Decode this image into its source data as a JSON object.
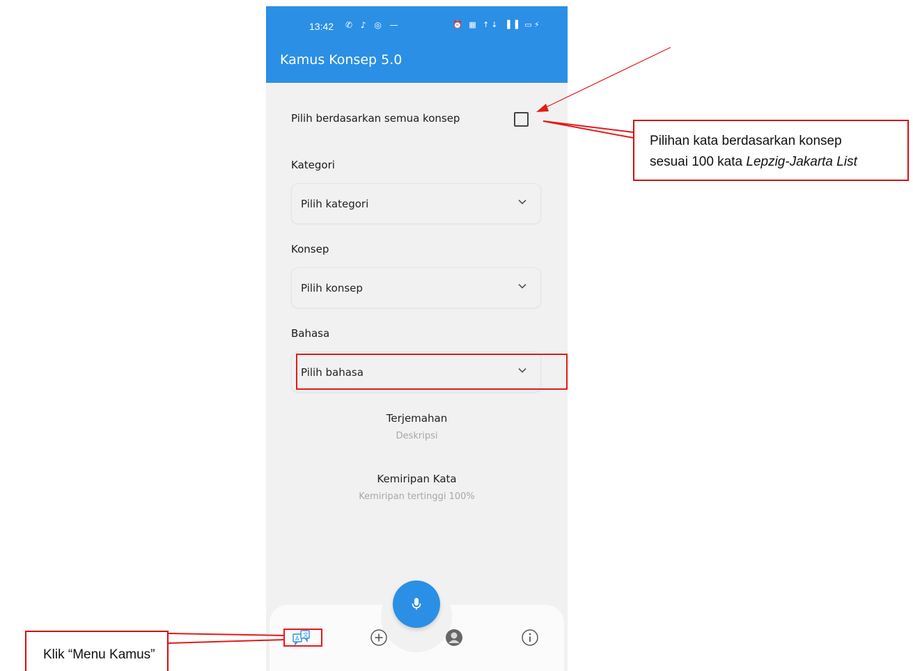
{
  "status_bar": {
    "time": "13:42",
    "left_icons": "✆ ♪ ◎ —",
    "right_icons": "⏰ ▦ ↑↓ ▐▐ ▭⚡"
  },
  "app": {
    "title": "Kamus Konsep 5.0",
    "accent_color": "#2b8fe6"
  },
  "form": {
    "all_concepts_label": "Pilih berdasarkan semua konsep",
    "all_concepts_checked": false,
    "category": {
      "label": "Kategori",
      "value": "Pilih kategori"
    },
    "concept": {
      "label": "Konsep",
      "value": "Pilih konsep"
    },
    "language": {
      "label": "Bahasa",
      "value": "Pilih bahasa"
    }
  },
  "results": {
    "translation_title": "Terjemahan",
    "translation_desc": "Deskripsi",
    "similarity_title": "Kemiripan Kata",
    "similarity_desc": "Kemiripan tertinggi 100%"
  },
  "bottom_nav": {
    "items": [
      "dictionary-icon",
      "add-icon",
      "profile-icon",
      "info-icon"
    ],
    "fab_icon": "microphone-icon"
  },
  "annotations": {
    "callout_line1": "Pilihan kata berdasarkan konsep",
    "callout_line2_prefix": "sesuai 100 kata ",
    "callout_line2_italic": "Lepzig-Jakarta List",
    "menu_callout": "Klik “Menu Kamus”",
    "annotation_color": "#e41919"
  }
}
